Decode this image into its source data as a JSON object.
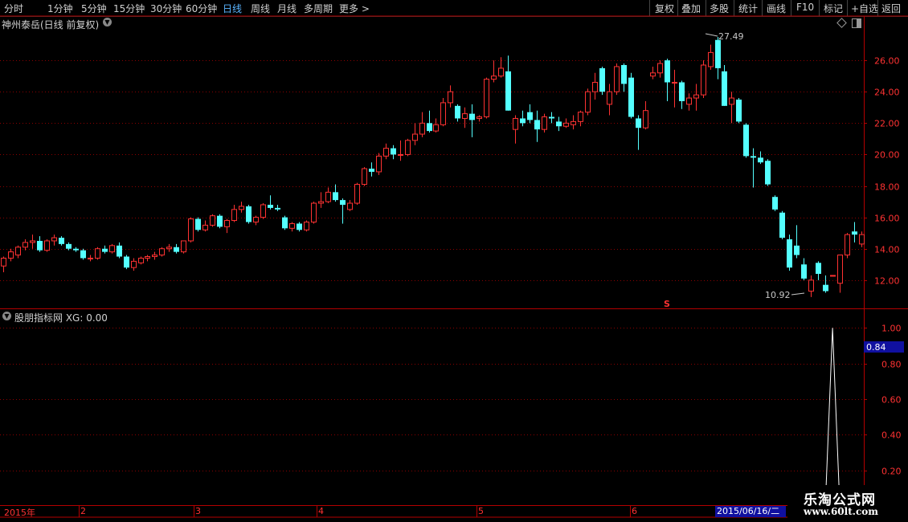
{
  "toolbar": {
    "periods": [
      "分时",
      "1分钟",
      "5分钟",
      "15分钟",
      "30分钟",
      "60分钟",
      "日线",
      "周线",
      "月线",
      "多周期",
      "更多 >"
    ],
    "active_period": "日线",
    "tools": [
      "复权",
      "叠加",
      "多股",
      "统计",
      "画线",
      "F10",
      "标记",
      "+自选",
      "返回"
    ]
  },
  "chart": {
    "title": "神州泰岳(日线 前复权)",
    "max_label": "27.49",
    "min_label": "10.92",
    "signal_marker": "S"
  },
  "indicator": {
    "title": "股朋指标网 XG: 0.00",
    "current_value": "0.84"
  },
  "date_axis": {
    "labels": [
      "2015年",
      "2",
      "3",
      "4",
      "5",
      "6"
    ],
    "selected_date": "2015/06/16/二"
  },
  "logo": {
    "name": "乐淘公式网",
    "url": "www.60lt.com"
  },
  "colors": {
    "up": "#ff3232",
    "down": "#54ffff",
    "grid": "#8b0000",
    "border": "#b40000",
    "selected_bg": "#1010a0"
  },
  "chart_data": [
    {
      "type": "candlestick",
      "title": "神州泰岳(日线 前复权)",
      "ylim": [
        10.2,
        27.9
      ],
      "yticks": [
        "26.00",
        "24.00",
        "22.00",
        "20.00",
        "18.00",
        "16.00",
        "14.00",
        "12.00"
      ],
      "candles": [
        {
          "o": 12.9,
          "h": 13.5,
          "l": 12.5,
          "c": 13.4
        },
        {
          "o": 13.4,
          "h": 14.0,
          "l": 13.2,
          "c": 13.8
        },
        {
          "o": 13.6,
          "h": 14.2,
          "l": 13.4,
          "c": 14.1
        },
        {
          "o": 14.1,
          "h": 14.6,
          "l": 13.9,
          "c": 14.4
        },
        {
          "o": 14.4,
          "h": 14.9,
          "l": 14.0,
          "c": 14.5
        },
        {
          "o": 14.5,
          "h": 14.8,
          "l": 13.8,
          "c": 13.9
        },
        {
          "o": 13.9,
          "h": 14.6,
          "l": 13.8,
          "c": 14.5
        },
        {
          "o": 14.5,
          "h": 14.9,
          "l": 14.2,
          "c": 14.7
        },
        {
          "o": 14.7,
          "h": 14.8,
          "l": 14.2,
          "c": 14.3
        },
        {
          "o": 14.3,
          "h": 14.4,
          "l": 13.9,
          "c": 14.0
        },
        {
          "o": 14.0,
          "h": 14.1,
          "l": 13.8,
          "c": 13.9
        },
        {
          "o": 13.9,
          "h": 14.0,
          "l": 13.3,
          "c": 13.4
        },
        {
          "o": 13.4,
          "h": 13.6,
          "l": 13.2,
          "c": 13.4
        },
        {
          "o": 13.4,
          "h": 14.1,
          "l": 13.3,
          "c": 14.0
        },
        {
          "o": 14.0,
          "h": 14.2,
          "l": 13.7,
          "c": 13.8
        },
        {
          "o": 13.8,
          "h": 14.3,
          "l": 13.7,
          "c": 14.2
        },
        {
          "o": 14.2,
          "h": 14.4,
          "l": 13.4,
          "c": 13.5
        },
        {
          "o": 13.5,
          "h": 13.6,
          "l": 12.7,
          "c": 12.8
        },
        {
          "o": 12.8,
          "h": 13.4,
          "l": 12.6,
          "c": 13.2
        },
        {
          "o": 13.1,
          "h": 13.5,
          "l": 13.0,
          "c": 13.4
        },
        {
          "o": 13.4,
          "h": 13.6,
          "l": 13.2,
          "c": 13.5
        },
        {
          "o": 13.5,
          "h": 13.8,
          "l": 13.3,
          "c": 13.6
        },
        {
          "o": 13.6,
          "h": 14.1,
          "l": 13.5,
          "c": 14.0
        },
        {
          "o": 14.0,
          "h": 14.3,
          "l": 13.8,
          "c": 14.1
        },
        {
          "o": 14.1,
          "h": 14.3,
          "l": 13.7,
          "c": 13.8
        },
        {
          "o": 13.8,
          "h": 14.5,
          "l": 13.7,
          "c": 14.5
        },
        {
          "o": 14.5,
          "h": 16.0,
          "l": 14.4,
          "c": 15.9
        },
        {
          "o": 15.9,
          "h": 16.0,
          "l": 15.1,
          "c": 15.2
        },
        {
          "o": 15.2,
          "h": 15.8,
          "l": 15.1,
          "c": 15.5
        },
        {
          "o": 15.5,
          "h": 16.2,
          "l": 15.4,
          "c": 16.1
        },
        {
          "o": 16.1,
          "h": 16.2,
          "l": 15.3,
          "c": 15.4
        },
        {
          "o": 15.4,
          "h": 15.9,
          "l": 15.0,
          "c": 15.8
        },
        {
          "o": 15.8,
          "h": 16.8,
          "l": 15.7,
          "c": 16.5
        },
        {
          "o": 16.5,
          "h": 17.0,
          "l": 16.3,
          "c": 16.7
        },
        {
          "o": 16.7,
          "h": 16.8,
          "l": 15.6,
          "c": 15.7
        },
        {
          "o": 15.7,
          "h": 16.1,
          "l": 15.5,
          "c": 16.0
        },
        {
          "o": 16.0,
          "h": 16.9,
          "l": 15.9,
          "c": 16.8
        },
        {
          "o": 16.8,
          "h": 17.4,
          "l": 16.5,
          "c": 16.6
        },
        {
          "o": 16.6,
          "h": 16.8,
          "l": 16.4,
          "c": 16.5
        },
        {
          "o": 16.0,
          "h": 16.1,
          "l": 15.2,
          "c": 15.3
        },
        {
          "o": 15.3,
          "h": 15.7,
          "l": 15.1,
          "c": 15.6
        },
        {
          "o": 15.6,
          "h": 15.7,
          "l": 15.1,
          "c": 15.2
        },
        {
          "o": 15.2,
          "h": 15.8,
          "l": 15.1,
          "c": 15.7
        },
        {
          "o": 15.7,
          "h": 17.0,
          "l": 15.6,
          "c": 16.9
        },
        {
          "o": 16.9,
          "h": 17.6,
          "l": 16.6,
          "c": 17.0
        },
        {
          "o": 17.0,
          "h": 17.9,
          "l": 16.9,
          "c": 17.6
        },
        {
          "o": 17.6,
          "h": 18.1,
          "l": 17.0,
          "c": 17.1
        },
        {
          "o": 17.1,
          "h": 17.2,
          "l": 15.6,
          "c": 16.8
        },
        {
          "o": 16.5,
          "h": 17.1,
          "l": 16.4,
          "c": 16.9
        },
        {
          "o": 16.9,
          "h": 18.2,
          "l": 16.8,
          "c": 18.1
        },
        {
          "o": 18.1,
          "h": 19.2,
          "l": 18.0,
          "c": 19.1
        },
        {
          "o": 19.1,
          "h": 19.5,
          "l": 18.6,
          "c": 18.9
        },
        {
          "o": 18.9,
          "h": 20.1,
          "l": 18.7,
          "c": 19.9
        },
        {
          "o": 19.9,
          "h": 20.7,
          "l": 19.7,
          "c": 20.4
        },
        {
          "o": 20.4,
          "h": 20.6,
          "l": 19.7,
          "c": 20.0
        },
        {
          "o": 20.0,
          "h": 20.9,
          "l": 19.6,
          "c": 20.0
        },
        {
          "o": 20.0,
          "h": 21.0,
          "l": 19.9,
          "c": 20.9
        },
        {
          "o": 20.9,
          "h": 22.0,
          "l": 20.6,
          "c": 21.3
        },
        {
          "o": 21.3,
          "h": 22.7,
          "l": 21.1,
          "c": 22.0
        },
        {
          "o": 22.0,
          "h": 22.8,
          "l": 21.4,
          "c": 21.5
        },
        {
          "o": 21.5,
          "h": 22.3,
          "l": 21.4,
          "c": 21.9
        },
        {
          "o": 21.9,
          "h": 23.6,
          "l": 21.8,
          "c": 23.3
        },
        {
          "o": 23.3,
          "h": 24.4,
          "l": 23.0,
          "c": 24.0
        },
        {
          "o": 23.1,
          "h": 23.2,
          "l": 22.1,
          "c": 22.3
        },
        {
          "o": 22.3,
          "h": 23.0,
          "l": 21.7,
          "c": 22.6
        },
        {
          "o": 22.6,
          "h": 23.2,
          "l": 21.1,
          "c": 22.2
        },
        {
          "o": 22.3,
          "h": 22.5,
          "l": 22.1,
          "c": 22.4
        },
        {
          "o": 22.4,
          "h": 24.9,
          "l": 22.3,
          "c": 24.8
        },
        {
          "o": 24.8,
          "h": 26.0,
          "l": 24.6,
          "c": 25.0
        },
        {
          "o": 25.0,
          "h": 26.2,
          "l": 24.9,
          "c": 25.5
        },
        {
          "o": 25.3,
          "h": 26.3,
          "l": 22.8,
          "c": 22.8
        },
        {
          "o": 21.6,
          "h": 22.5,
          "l": 20.7,
          "c": 22.3
        },
        {
          "o": 22.3,
          "h": 22.8,
          "l": 21.8,
          "c": 22.0
        },
        {
          "o": 22.7,
          "h": 23.2,
          "l": 22.0,
          "c": 22.2
        },
        {
          "o": 22.2,
          "h": 22.8,
          "l": 20.8,
          "c": 21.6
        },
        {
          "o": 21.6,
          "h": 22.6,
          "l": 21.4,
          "c": 22.4
        },
        {
          "o": 22.4,
          "h": 22.7,
          "l": 22.0,
          "c": 22.3
        },
        {
          "o": 22.1,
          "h": 22.4,
          "l": 21.5,
          "c": 21.8
        },
        {
          "o": 21.8,
          "h": 22.3,
          "l": 21.7,
          "c": 22.0
        },
        {
          "o": 21.9,
          "h": 22.5,
          "l": 21.6,
          "c": 22.1
        },
        {
          "o": 22.1,
          "h": 22.8,
          "l": 21.8,
          "c": 22.7
        },
        {
          "o": 22.7,
          "h": 24.2,
          "l": 22.5,
          "c": 24.0
        },
        {
          "o": 24.0,
          "h": 25.2,
          "l": 23.5,
          "c": 24.6
        },
        {
          "o": 25.5,
          "h": 25.6,
          "l": 23.8,
          "c": 24.0
        },
        {
          "o": 23.2,
          "h": 24.5,
          "l": 22.5,
          "c": 24.0
        },
        {
          "o": 24.0,
          "h": 25.8,
          "l": 23.8,
          "c": 25.6
        },
        {
          "o": 25.7,
          "h": 25.8,
          "l": 24.0,
          "c": 24.5
        },
        {
          "o": 24.9,
          "h": 25.2,
          "l": 22.3,
          "c": 22.4
        },
        {
          "o": 22.3,
          "h": 22.5,
          "l": 20.3,
          "c": 21.7
        },
        {
          "o": 21.7,
          "h": 23.4,
          "l": 21.6,
          "c": 22.8
        },
        {
          "o": 25.0,
          "h": 25.6,
          "l": 24.8,
          "c": 25.2
        },
        {
          "o": 25.2,
          "h": 26.0,
          "l": 24.9,
          "c": 25.8
        },
        {
          "o": 26.0,
          "h": 26.1,
          "l": 23.4,
          "c": 24.6
        },
        {
          "o": 24.6,
          "h": 25.4,
          "l": 23.0,
          "c": 24.6
        },
        {
          "o": 24.6,
          "h": 24.7,
          "l": 22.9,
          "c": 23.4
        },
        {
          "o": 23.2,
          "h": 23.9,
          "l": 22.8,
          "c": 23.6
        },
        {
          "o": 23.6,
          "h": 24.5,
          "l": 22.8,
          "c": 23.8
        },
        {
          "o": 23.8,
          "h": 26.0,
          "l": 23.6,
          "c": 25.7
        },
        {
          "o": 25.6,
          "h": 27.0,
          "l": 25.4,
          "c": 26.5
        },
        {
          "o": 27.3,
          "h": 27.49,
          "l": 24.8,
          "c": 25.5
        },
        {
          "o": 25.3,
          "h": 25.7,
          "l": 23.1,
          "c": 23.1
        },
        {
          "o": 23.2,
          "h": 24.0,
          "l": 22.0,
          "c": 23.6
        },
        {
          "o": 23.5,
          "h": 23.6,
          "l": 22.0,
          "c": 22.1
        },
        {
          "o": 21.9,
          "h": 22.0,
          "l": 19.8,
          "c": 19.9
        },
        {
          "o": 19.9,
          "h": 20.4,
          "l": 17.9,
          "c": 19.8
        },
        {
          "o": 19.8,
          "h": 20.2,
          "l": 19.4,
          "c": 19.5
        },
        {
          "o": 19.6,
          "h": 19.7,
          "l": 18.0,
          "c": 18.1
        },
        {
          "o": 17.3,
          "h": 17.4,
          "l": 16.4,
          "c": 16.5
        },
        {
          "o": 16.3,
          "h": 16.4,
          "l": 14.6,
          "c": 14.7
        },
        {
          "o": 14.6,
          "h": 14.9,
          "l": 12.6,
          "c": 12.8
        },
        {
          "o": 14.2,
          "h": 15.5,
          "l": 13.4,
          "c": 13.6
        },
        {
          "o": 13.0,
          "h": 13.4,
          "l": 12.0,
          "c": 12.1
        },
        {
          "o": 11.3,
          "h": 12.3,
          "l": 10.92,
          "c": 12.0
        },
        {
          "o": 13.1,
          "h": 13.2,
          "l": 12.0,
          "c": 12.4
        },
        {
          "o": 11.7,
          "h": 12.3,
          "l": 11.2,
          "c": 11.3
        },
        {
          "o": 12.3,
          "h": 12.3,
          "l": 12.3,
          "c": 12.3
        },
        {
          "o": 11.8,
          "h": 13.3,
          "l": 11.2,
          "c": 13.6
        },
        {
          "o": 13.6,
          "h": 15.0,
          "l": 13.4,
          "c": 14.9
        },
        {
          "o": 15.1,
          "h": 15.7,
          "l": 14.4,
          "c": 14.9
        },
        {
          "o": 14.3,
          "h": 15.1,
          "l": 14.1,
          "c": 14.9
        }
      ]
    },
    {
      "type": "line",
      "title": "股朋指标网 XG: 0.00",
      "ylim": [
        0.0,
        1.06
      ],
      "yticks": [
        "1.00",
        "0.80",
        "0.60",
        "0.40",
        "0.20"
      ],
      "points_nonzero": [
        {
          "index": 114,
          "y": 0.0
        },
        {
          "index": 115,
          "y": 1.0
        },
        {
          "index": 116,
          "y": 0.0
        }
      ]
    }
  ]
}
